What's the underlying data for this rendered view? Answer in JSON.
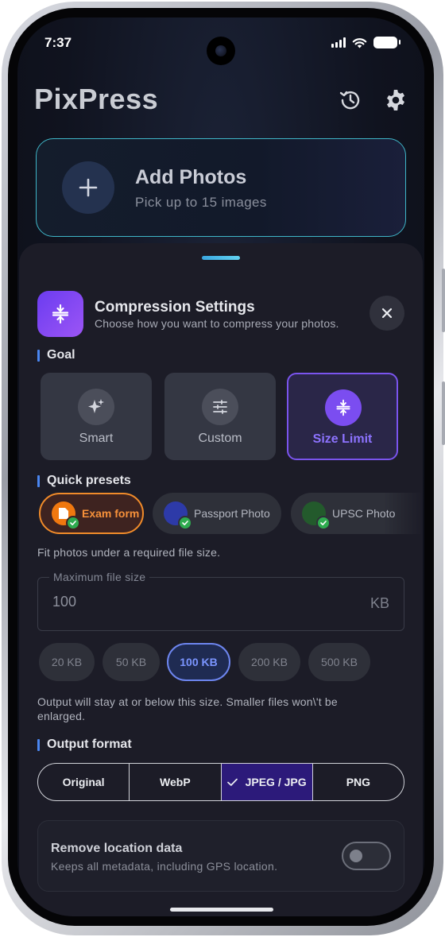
{
  "status_bar": {
    "time": "7:37"
  },
  "app": {
    "title": "PixPress"
  },
  "header_icons": {
    "history": "history-icon",
    "settings": "gear-icon"
  },
  "add_photos": {
    "title": "Add Photos",
    "subtitle": "Pick up to 15 images",
    "icon": "plus-icon"
  },
  "sheet": {
    "title": "Compression Settings",
    "subtitle": "Choose how you want to compress your photos.",
    "close_icon": "close-icon"
  },
  "goal": {
    "label": "Goal",
    "options": [
      {
        "label": "Smart",
        "icon": "sparkle-icon",
        "selected": false
      },
      {
        "label": "Custom",
        "icon": "sliders-icon",
        "selected": false
      },
      {
        "label": "Size Limit",
        "icon": "compress-icon",
        "selected": true
      }
    ]
  },
  "presets": {
    "label": "Quick presets",
    "items": [
      {
        "label": "Exam form",
        "selected": true,
        "color": "#f0780f"
      },
      {
        "label": "Passport Photo",
        "selected": false,
        "color": "#3a48c8"
      },
      {
        "label": "UPSC Photo",
        "selected": false,
        "color": "#2d8a3a"
      }
    ],
    "helper": "Fit photos under a required file size."
  },
  "max_size": {
    "label": "Maximum file size",
    "value": "100",
    "unit": "KB",
    "chips": [
      "20 KB",
      "50 KB",
      "100 KB",
      "200 KB",
      "500 KB"
    ],
    "selected_chip": "100 KB",
    "helper": "Output will stay at or below this size. Smaller files won\\'t be enlarged."
  },
  "output_format": {
    "label": "Output format",
    "options": [
      "Original",
      "WebP",
      "JPEG / JPG",
      "PNG"
    ],
    "selected": "JPEG / JPG"
  },
  "location": {
    "title": "Remove location data",
    "subtitle": "Keeps all metadata, including GPS location.",
    "enabled": false
  },
  "colors": {
    "accent": "#7a54ee",
    "preset_active": "#f08b2a",
    "info_blue": "#4a86f0"
  }
}
